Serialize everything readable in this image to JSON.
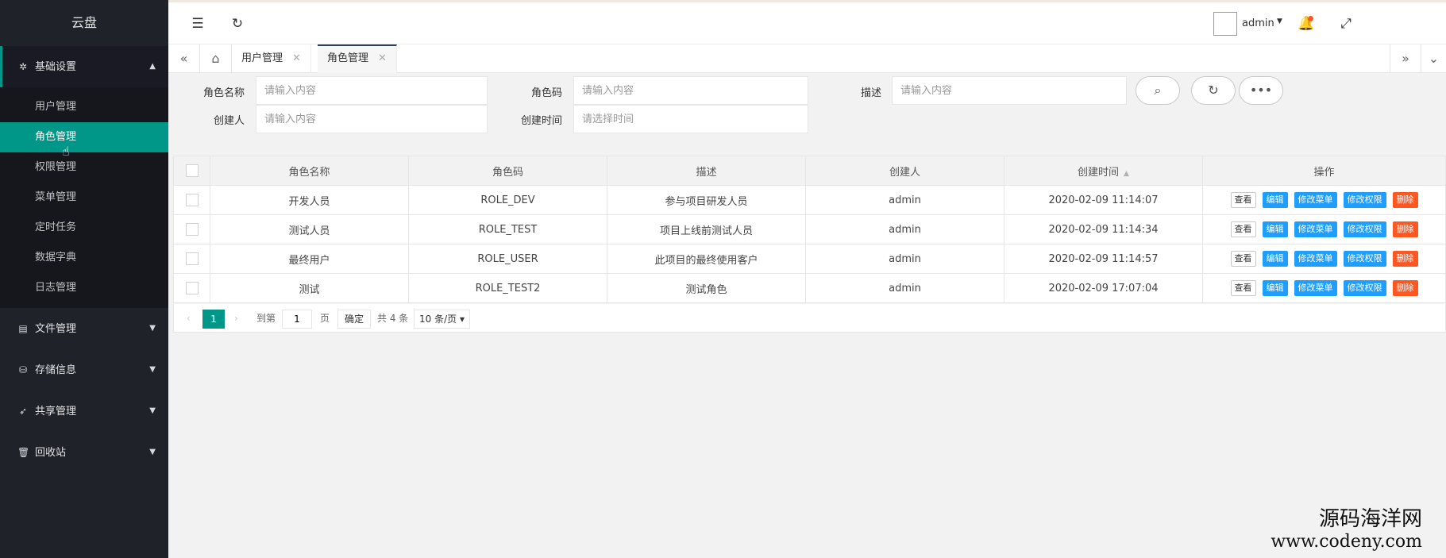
{
  "sidebar": {
    "logo": "云盘",
    "groups": [
      {
        "label": "基础设置",
        "icon": "gear-icon"
      },
      {
        "label": "文件管理",
        "icon": "file-icon"
      },
      {
        "label": "存储信息",
        "icon": "storage-icon"
      },
      {
        "label": "共享管理",
        "icon": "share-icon"
      },
      {
        "label": "回收站",
        "icon": "trash-icon"
      }
    ],
    "sub_items": [
      "用户管理",
      "角色管理",
      "权限管理",
      "菜单管理",
      "定时任务",
      "数据字典",
      "日志管理"
    ]
  },
  "header": {
    "user": "admin"
  },
  "tabs": [
    {
      "label": "用户管理"
    },
    {
      "label": "角色管理"
    }
  ],
  "search": {
    "role_name_label": "角色名称",
    "role_code_label": "角色码",
    "desc_label": "描述",
    "creator_label": "创建人",
    "created_time_label": "创建时间",
    "input_placeholder": "请输入内容",
    "time_placeholder": "请选择时间"
  },
  "table": {
    "headers": [
      "角色名称",
      "角色码",
      "描述",
      "创建人",
      "创建时间",
      "操作"
    ],
    "rows": [
      [
        "开发人员",
        "ROLE_DEV",
        "参与项目研发人员",
        "admin",
        "2020-02-09 11:14:07"
      ],
      [
        "测试人员",
        "ROLE_TEST",
        "项目上线前测试人员",
        "admin",
        "2020-02-09 11:14:34"
      ],
      [
        "最终用户",
        "ROLE_USER",
        "此项目的最终使用客户",
        "admin",
        "2020-02-09 11:14:57"
      ],
      [
        "测试",
        "ROLE_TEST2",
        "测试角色",
        "admin",
        "2020-02-09 17:07:04"
      ]
    ],
    "actions": {
      "view": "查看",
      "edit": "编辑",
      "edit_menu": "修改菜单",
      "edit_perm": "修改权限",
      "delete": "删除"
    }
  },
  "pager": {
    "current": "1",
    "goto_label": "到第",
    "goto_value": "1",
    "page_unit": "页",
    "confirm": "确定",
    "total": "共 4 条",
    "page_size": "10 条/页"
  },
  "watermark": {
    "line1": "源码海洋网",
    "line2": "www.codeny.com"
  }
}
